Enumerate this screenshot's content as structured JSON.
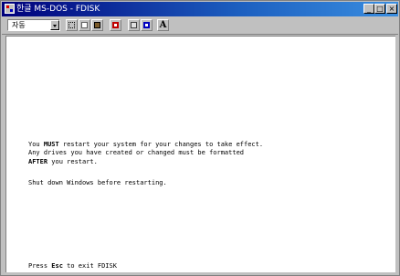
{
  "window": {
    "title": "한글 MS-DOS - FDISK",
    "minimize_glyph": "_",
    "maximize_glyph": "□",
    "close_glyph": "×"
  },
  "toolbar": {
    "font_select_value": "자동",
    "font_letter": "A",
    "icons": [
      "mark-icon",
      "copy-icon",
      "paste-icon",
      "full-screen-icon",
      "properties-icon",
      "background-icon",
      "font-icon"
    ]
  },
  "screen": {
    "msg1_pre": "You ",
    "msg1_bold": "MUST",
    "msg1_post": " restart your system for your changes to take effect.",
    "msg2": "Any drives you have created or changed must be formatted",
    "msg3_bold": "AFTER",
    "msg3_post": " you restart.",
    "msg4": "Shut down Windows before restarting.",
    "footer_pre": "Press ",
    "footer_key": "Esc",
    "footer_post": " to exit FDISK"
  },
  "colors": {
    "titlebar_start": "#00007b",
    "titlebar_end": "#3a8ee0",
    "console_bg": "#ffffff",
    "console_text": "#000000"
  }
}
